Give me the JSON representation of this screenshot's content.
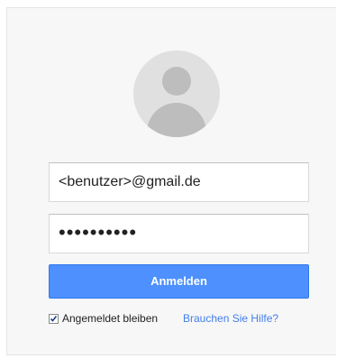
{
  "login": {
    "avatar_icon": "default-user-avatar",
    "email_value": "<benutzer>@gmail.de",
    "password_masked": "••••••••••",
    "signin_label": "Anmelden",
    "stay_signed_in": {
      "label": "Angemeldet bleiben",
      "checked": true
    },
    "help_link": "Brauchen Sie Hilfe?"
  },
  "colors": {
    "accent": "#4d90fe",
    "link": "#427fed",
    "card_bg": "#f7f7f7"
  }
}
